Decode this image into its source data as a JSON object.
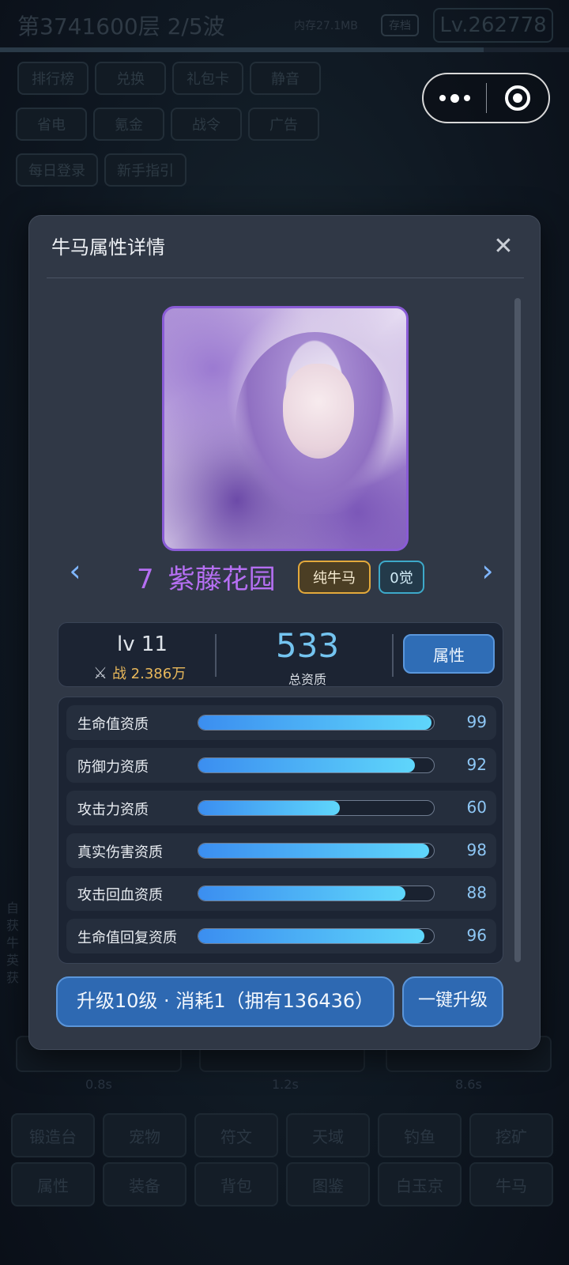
{
  "background": {
    "floor_text": "第3741600层  2/5波",
    "memory_text": "内存27.1MB",
    "save_label": "存档",
    "level_text": "Lv.262778",
    "progress_fraction": 0.85,
    "top_buttons_row1": [
      "排行榜",
      "兑换",
      "礼包卡",
      "静音"
    ],
    "top_buttons_row2": [
      "省电",
      "氪金",
      "战令",
      "广告"
    ],
    "top_buttons_row3": [
      "每日登录",
      "新手指引"
    ],
    "log_lines": [
      "自",
      "获",
      "牛",
      "英",
      "获"
    ],
    "timers": [
      "0.8s",
      "1.2s",
      "8.6s"
    ],
    "bottom_menu_row1": [
      "锻造台",
      "宠物",
      "符文",
      "天域",
      "钓鱼",
      "挖矿"
    ],
    "bottom_menu_row2": [
      "属性",
      "装备",
      "背包",
      "图鉴",
      "白玉京",
      "牛马"
    ]
  },
  "modal": {
    "title": "牛马属性详情",
    "close_symbol": "✕",
    "character": {
      "index": "7",
      "name": "紫藤花园",
      "type_tag": "纯牛马",
      "awaken_tag": "0觉"
    },
    "nav_prev": "‹",
    "nav_next": "›",
    "stats": {
      "level": "lv 11",
      "power_icon": "⚔",
      "power": "战 2.386万",
      "total_value": "533",
      "total_label": "总资质",
      "attr_button": "属性"
    },
    "aptitudes": [
      {
        "label": "生命值资质",
        "value": "99",
        "fraction": 0.99
      },
      {
        "label": "防御力资质",
        "value": "92",
        "fraction": 0.92
      },
      {
        "label": "攻击力资质",
        "value": "60",
        "fraction": 0.6
      },
      {
        "label": "真实伤害资质",
        "value": "98",
        "fraction": 0.98
      },
      {
        "label": "攻击回血资质",
        "value": "88",
        "fraction": 0.88
      },
      {
        "label": "生命值回复资质",
        "value": "96",
        "fraction": 0.96
      }
    ],
    "upgrade_button": "升级10级 · 消耗1（拥有136436）",
    "oneclick_button": "一键升级"
  },
  "colors": {
    "accent_blue": "#2e69b2",
    "name_purple": "#b56ff2",
    "power_gold": "#e8b85b",
    "bar_start": "#3b8ef0",
    "bar_end": "#5fd6fb"
  }
}
